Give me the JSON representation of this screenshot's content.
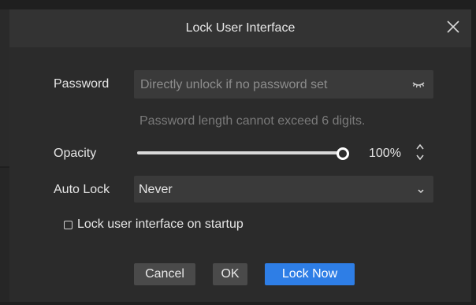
{
  "dialog": {
    "title": "Lock User Interface",
    "close_icon": "close-icon"
  },
  "password": {
    "label": "Password",
    "placeholder": "Directly unlock if no password set",
    "value": "",
    "toggle_icon": "eye-closed-icon",
    "hint": "Password length cannot exceed 6 digits."
  },
  "opacity": {
    "label": "Opacity",
    "value": 1.0,
    "display": "100%",
    "spin_icon": "chevron-up-down-icon"
  },
  "auto_lock": {
    "label": "Auto Lock",
    "selected": "Never",
    "dropdown_icon": "chevron-down-icon"
  },
  "startup": {
    "label": "Lock user interface on startup",
    "checked": false
  },
  "buttons": {
    "cancel": "Cancel",
    "ok": "OK",
    "lock_now": "Lock Now"
  },
  "colors": {
    "accent": "#2e7ee6",
    "dialog_bg": "#2b2b2b",
    "titlebar_bg": "#333333",
    "field_bg": "#3a3a3a"
  }
}
